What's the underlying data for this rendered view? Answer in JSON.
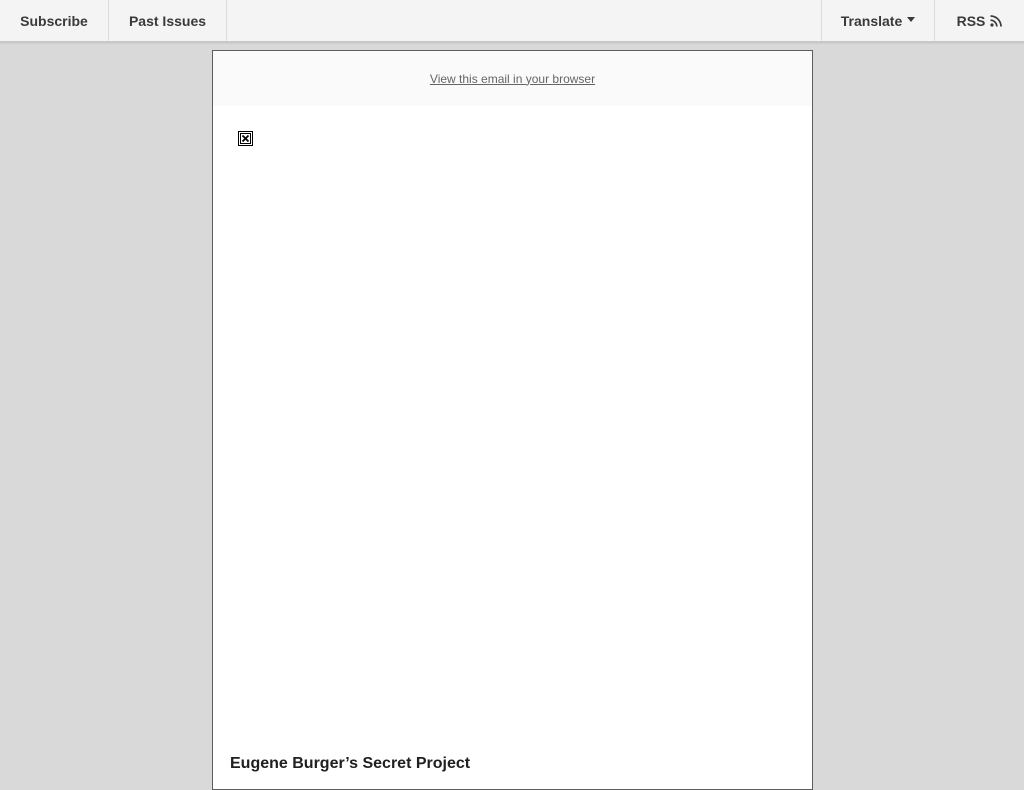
{
  "nav": {
    "subscribe": "Subscribe",
    "past_issues": "Past Issues",
    "translate": "Translate",
    "rss": "RSS"
  },
  "email": {
    "view_in_browser": "View this email in your browser",
    "headline": "Eugene Burger’s Secret Project"
  },
  "icons": {
    "translate_dropdown": "caret-down-icon",
    "rss": "rss-icon",
    "broken_image": "broken-image-icon"
  },
  "colors": {
    "page_background": "#d9d9d9",
    "nav_background": "#f4f4f4",
    "email_background": "#ffffff",
    "link": "#656565"
  }
}
